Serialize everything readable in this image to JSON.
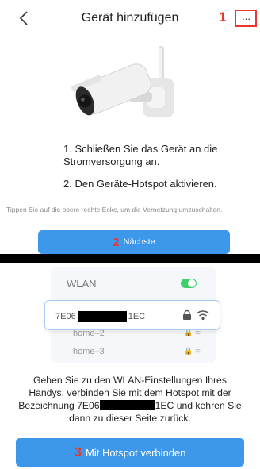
{
  "header": {
    "title": "Gerät hinzufügen",
    "annotation": "1",
    "more_label": "···"
  },
  "steps": {
    "step1": "1. Schließen Sie das Gerät an die Stromversorgung an.",
    "step2": "2. Den Geräte-Hotspot aktivieren.",
    "hint": "Tippen Sie auf die obere rechte Ecke, um die Vernetzung umzuschalten."
  },
  "next_button": {
    "annotation": "2",
    "label": "Nächste"
  },
  "wifi_illustration": {
    "section_label": "WLAN",
    "toggle_on": true,
    "network_prefix": "7E06",
    "network_suffix": "1EC",
    "ghost_network": "home–2",
    "network_3": "home–3"
  },
  "instruction": {
    "part1": "Gehen Sie zu den WLAN-Einstellungen Ihres Handys, verbinden Sie mit dem Hotspot mit der Bezeichnung 7E06",
    "part2": "1EC und kehren Sie dann zu dieser Seite zurück."
  },
  "connect_button": {
    "annotation": "3",
    "label": "Mit Hotspot verbinden"
  },
  "colors": {
    "accent": "#3d97ea",
    "annotation_red": "#e8382b",
    "toggle_green": "#3fcf6a"
  }
}
